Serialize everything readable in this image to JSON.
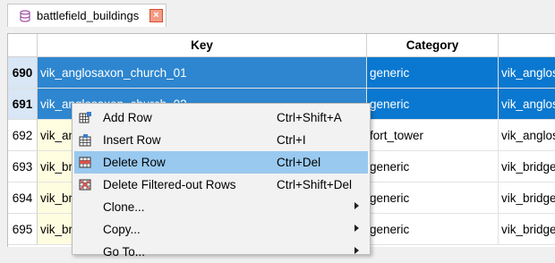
{
  "tab": {
    "title": "battlefield_buildings",
    "close_glyph": "×"
  },
  "columns": [
    "Key",
    "Category"
  ],
  "rows": [
    {
      "num": "690",
      "key": "vik_anglosaxon_church_01",
      "category": "generic",
      "extra": "vik_anglos",
      "state": "selected"
    },
    {
      "num": "691",
      "key": "vik_anglosaxon_church_02",
      "category": "generic",
      "extra": "vik_anglos",
      "state": "selected"
    },
    {
      "num": "692",
      "key": "vik_anglosaxon_fort_01",
      "category": "fort_tower",
      "extra": "vik_anglos",
      "state": "normal"
    },
    {
      "num": "693",
      "key": "vik_bridge_01",
      "category": "generic",
      "extra": "vik_bridge",
      "state": "normal"
    },
    {
      "num": "694",
      "key": "vik_bridge_02",
      "category": "generic",
      "extra": "vik_bridge",
      "state": "normal"
    },
    {
      "num": "695",
      "key": "vik_bridge_03",
      "category": "generic",
      "extra": "vik_bridge",
      "state": "normal"
    }
  ],
  "menu": {
    "items": [
      {
        "label": "Add Row",
        "shortcut": "Ctrl+Shift+A",
        "icon": "add-row-icon"
      },
      {
        "label": "Insert Row",
        "shortcut": "Ctrl+I",
        "icon": "insert-row-icon"
      },
      {
        "label": "Delete Row",
        "shortcut": "Ctrl+Del",
        "icon": "delete-row-icon",
        "highlighted": true
      },
      {
        "label": "Delete Filtered-out Rows",
        "shortcut": "Ctrl+Shift+Del",
        "icon": "delete-filtered-rows-icon"
      },
      {
        "label": "Clone...",
        "shortcut": "",
        "submenu": true
      },
      {
        "label": "Copy...",
        "shortcut": "",
        "submenu": true
      },
      {
        "label": "Go To...",
        "shortcut": "",
        "submenu": true
      }
    ]
  },
  "colors": {
    "selection": "#0a78d0",
    "menu_highlight": "#99c9ef"
  }
}
